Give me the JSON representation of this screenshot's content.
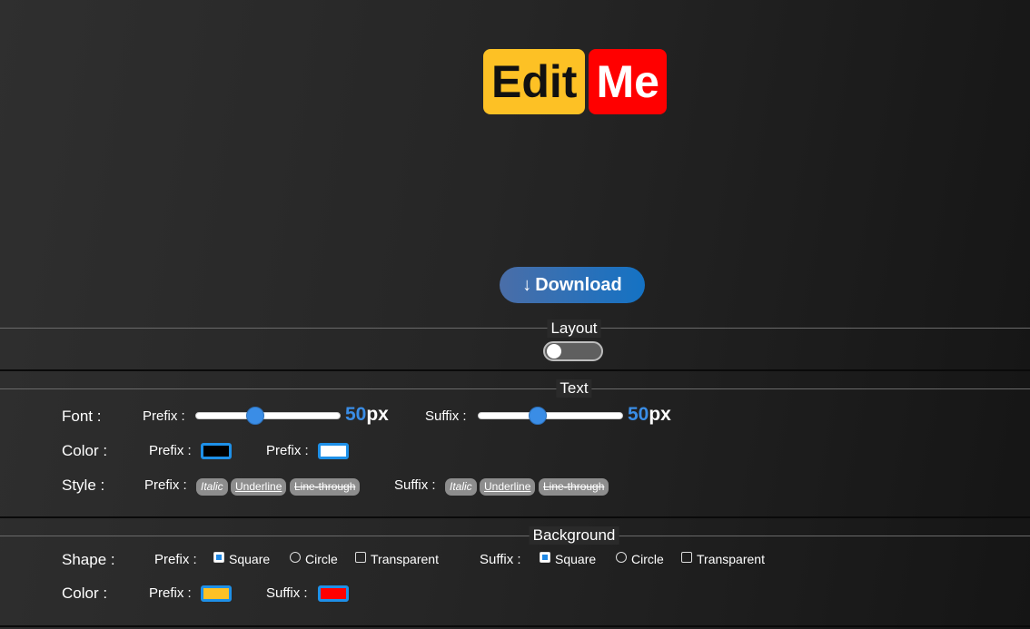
{
  "logo": {
    "prefix": "Edit",
    "suffix": "Me",
    "prefix_bg": "#fdc125",
    "suffix_bg": "#ff0000"
  },
  "download": {
    "icon": "↓",
    "label": "Download"
  },
  "layout": {
    "title": "Layout",
    "toggle_on": false
  },
  "text": {
    "title": "Text",
    "font_label": "Font :",
    "font_prefix_label": "Prefix :",
    "font_prefix_value": "50",
    "font_suffix_label": "Suffix :",
    "font_suffix_value": "50",
    "unit": "px",
    "color_label": "Color :",
    "color_prefix_label": "Prefix :",
    "color_suffix_label": "Prefix :",
    "color_prefix": "#000000",
    "color_suffix": "#ffffff",
    "style_label": "Style :",
    "style_prefix_label": "Prefix :",
    "style_suffix_label": "Suffix :",
    "chips": {
      "italic": "Italic",
      "underline": "Underline",
      "strike": "Line-through"
    }
  },
  "background": {
    "title": "Background",
    "shape_label": "Shape :",
    "shape_prefix_label": "Prefix :",
    "shape_suffix_label": "Suffix :",
    "opt_square": "Square",
    "opt_circle": "Circle",
    "opt_transparent": "Transparent",
    "color_label": "Color :",
    "color_prefix_label": "Prefix :",
    "color_suffix_label": "Suffix :",
    "color_prefix": "#fdc125",
    "color_suffix": "#ff0000"
  }
}
